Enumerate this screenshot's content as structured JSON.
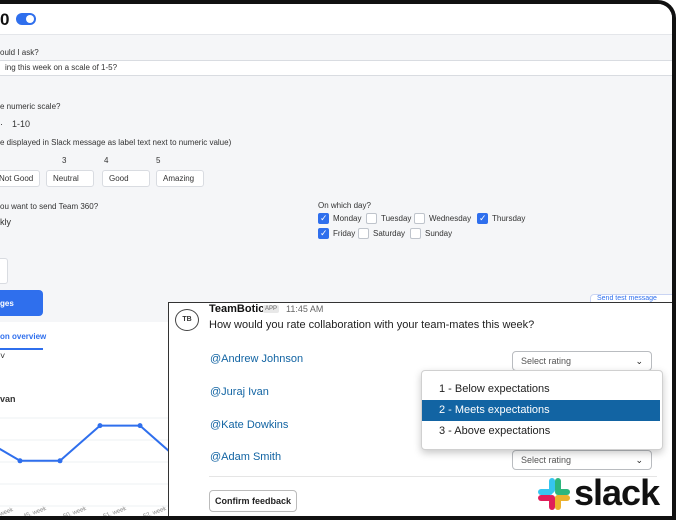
{
  "header": {
    "title": "0"
  },
  "form": {
    "question_label": "ould I ask?",
    "question_value": "ing this week on a scale of 1-5?",
    "scale_label": "e numeric scale?",
    "scale_value": "1-10",
    "labels_hint": "e displayed in Slack message as label text next to numeric value)",
    "scale_numbers": [
      "3",
      "4",
      "5"
    ],
    "label_inputs": [
      "Not Good",
      "Neutral",
      "Good",
      "Amazing"
    ],
    "send_when_label": "ou want to send Team 360?",
    "frequency": "kly",
    "day_label": "On which day?",
    "days": [
      {
        "label": "Monday",
        "checked": true
      },
      {
        "label": "Tuesday",
        "checked": false
      },
      {
        "label": "Wednesday",
        "checked": true
      },
      {
        "label": "Thursday",
        "checked": false
      },
      {
        "label": "Friday",
        "checked": true
      },
      {
        "label": "Saturday",
        "checked": false
      },
      {
        "label": "Sunday",
        "checked": false
      }
    ],
    "action_button": "ges",
    "right_button": "Send test message",
    "tab_label": "on overview",
    "person_label": "van"
  },
  "chart_data": {
    "type": "line",
    "x": [
      "6. week",
      "45. week",
      "50. week",
      "51. week",
      "52. week",
      "1. week",
      "9. week"
    ],
    "values": [
      4,
      3,
      3,
      5,
      5,
      3,
      2
    ],
    "ylim": [
      1,
      6
    ],
    "color": "#2f6fed"
  },
  "slack": {
    "bot_name": "TeamBotic",
    "app_badge": "APP",
    "time": "11:45 AM",
    "avatar_text": "TB",
    "question": "How would you rate collaboration with your team-mates this week?",
    "members": [
      "@Andrew Johnson",
      "@Juraj Ivan",
      "@Kate Dowkins",
      "@Adam Smith"
    ],
    "select_placeholder": "Select rating",
    "options": [
      "1 - Below expectations",
      "2 - Meets expectations",
      "3 - Above expectations"
    ],
    "highlighted_option": 1,
    "confirm": "Confirm feedback",
    "brand": "slack"
  },
  "colors": {
    "accent": "#2f6fed",
    "slack_link": "#1264a3"
  }
}
